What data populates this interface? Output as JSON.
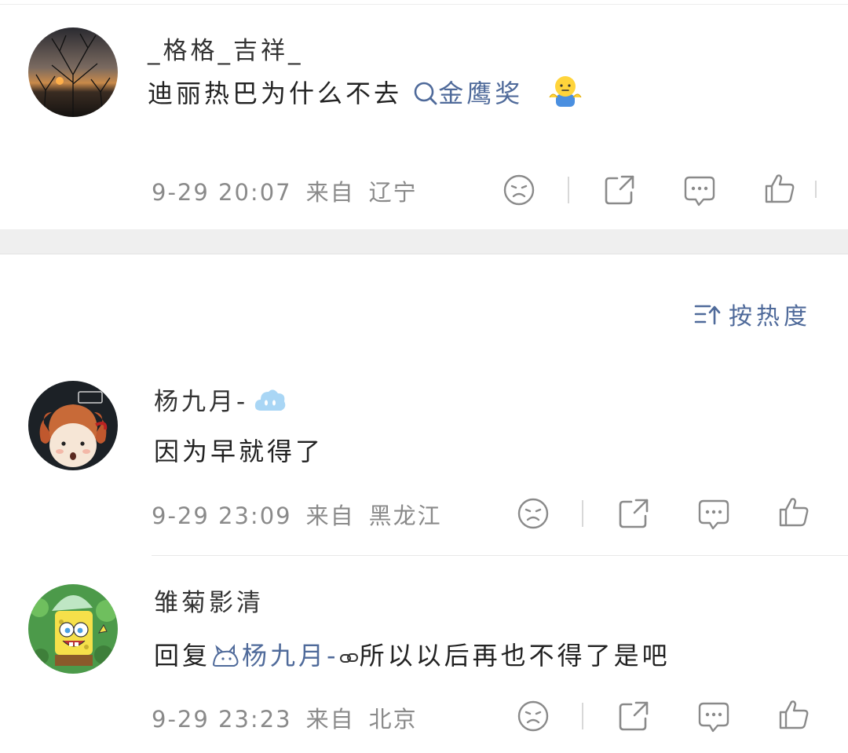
{
  "post": {
    "username": "_格格_吉祥_",
    "text": "迪丽热巴为什么不去",
    "topic_link": "金鹰奖",
    "time": "9-29 20:07",
    "from_label": "来自",
    "location": "辽宁"
  },
  "sort": {
    "label": "按热度"
  },
  "comments": [
    {
      "username": "杨九月-",
      "text": "因为早就得了",
      "time": "9-29 23:09",
      "from_label": "来自",
      "location": "黑龙江"
    },
    {
      "username": "雏菊影清",
      "reply_prefix": "回复",
      "reply_to": "杨九月-",
      "text": "所以以后再也不得了是吧",
      "time": "9-29 23:23",
      "from_label": "来自",
      "location": "北京"
    }
  ],
  "icons": [
    "dislike-icon",
    "share-icon",
    "comment-icon",
    "like-icon",
    "search-icon",
    "sort-icon"
  ],
  "colors": {
    "link": "#4f6a9a",
    "meta": "#8a8a8a",
    "icon": "#8a8a8a",
    "band": "#efefef"
  }
}
